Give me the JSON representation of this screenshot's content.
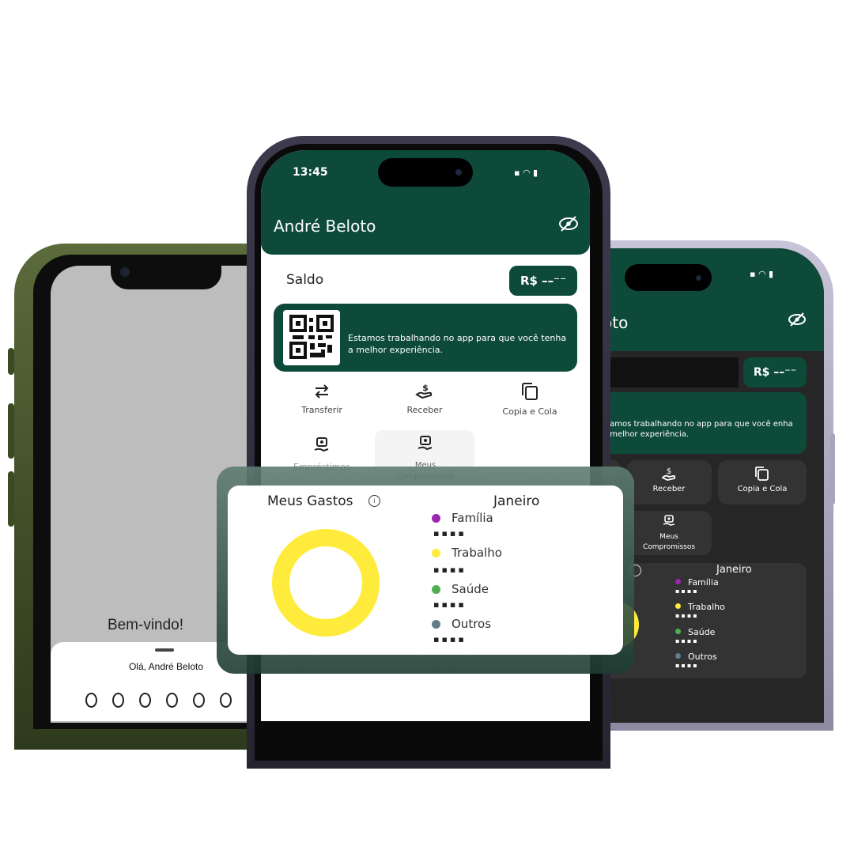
{
  "left_phone": {
    "welcome": "Bem-vindo!",
    "greeting": "Olá, André Beloto",
    "pin_length": 6
  },
  "center_phone": {
    "status_time": "13:45",
    "user_name": "André Beloto",
    "balance_label": "Saldo",
    "balance_value": "R$ ––⁻⁻",
    "banner_text": "Estamos trabalhando no app para que você tenha a melhor experiência.",
    "actions": [
      {
        "label": "Transferir",
        "icon": "transfer-icon"
      },
      {
        "label": "Receber",
        "icon": "receive-money-icon"
      },
      {
        "label": "Copia e Cola",
        "icon": "copy-paste-icon"
      },
      {
        "label": "Empréstimos",
        "icon": "loan-icon"
      },
      {
        "label": "Meus Compromissos",
        "icon": "commitments-icon"
      }
    ]
  },
  "gastos": {
    "title": "Meus Gastos",
    "month": "Janeiro",
    "legend": [
      {
        "label": "Família",
        "color": "#9c27b0"
      },
      {
        "label": "Trabalho",
        "color": "#ffeb3b"
      },
      {
        "label": "Saúde",
        "color": "#4caf50"
      },
      {
        "label": "Outros",
        "color": "#607d8b"
      }
    ],
    "donut_color": "#ffeb3b"
  },
  "right_phone": {
    "title_fragment": "oto",
    "balance_value": "R$ ––⁻⁻",
    "banner_text": "stamos trabalhando no app para que você enha a melhor experiência.",
    "actions": [
      {
        "label": "Receber",
        "icon": "receive-money-icon"
      },
      {
        "label": "Copia e Cola",
        "icon": "copy-paste-icon"
      },
      {
        "label": "Meus Compromissos",
        "icon": "commitments-icon"
      }
    ],
    "month": "Janeiro",
    "legend": [
      "Família",
      "Trabalho",
      "Saúde",
      "Outros"
    ]
  },
  "colors": {
    "brand_green": "#0e4a3a",
    "dark_bg": "#262626"
  }
}
